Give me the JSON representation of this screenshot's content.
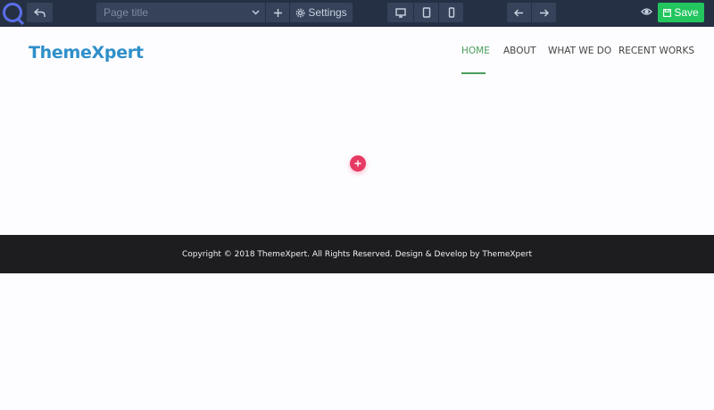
{
  "toolbar": {
    "page_title_placeholder": "Page title",
    "settings_label": "Settings",
    "save_label": "Save",
    "save_color": "#22c55e"
  },
  "site": {
    "brand": "ThemeXpert",
    "nav": [
      {
        "label": "HOME",
        "active": true
      },
      {
        "label": "ABOUT",
        "active": false
      },
      {
        "label": "WHAT WE DO",
        "active": false
      },
      {
        "label": "RECENT WORKS",
        "active": false
      }
    ],
    "accent_color": "#4a9d5b"
  },
  "footer": {
    "copyright": "Copyright © 2018 ThemeXpert. All Rights Reserved. Design & Develop by ThemeXpert"
  },
  "icons": [
    "quix-logo-icon",
    "undo-icon",
    "chevron-down-icon",
    "plus-icon",
    "gear-icon",
    "desktop-icon",
    "tablet-icon",
    "mobile-icon",
    "arrow-left-icon",
    "arrow-right-icon",
    "eye-icon",
    "save-icon",
    "add-section-icon"
  ]
}
